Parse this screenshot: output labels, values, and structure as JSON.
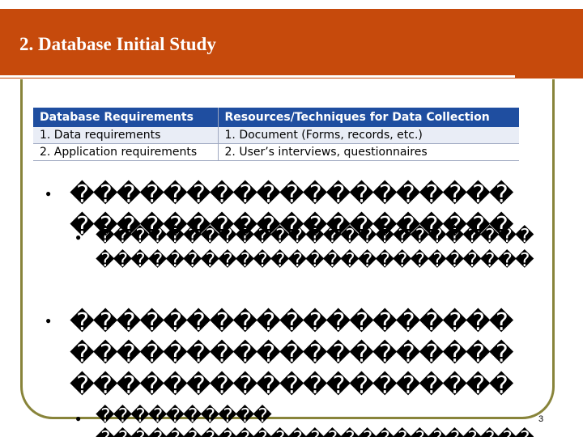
{
  "slide": {
    "title": "2. Database Initial Study",
    "page_number": "3"
  },
  "table": {
    "headers": [
      "Database Requirements",
      "Resources/Techniques for Data Collection"
    ],
    "rows": [
      [
        "1.  Data requirements",
        "1.  Document (Forms, records, etc.)"
      ],
      [
        "2.  Application requirements",
        "2.  User’s interviews, questionnaires"
      ]
    ]
  },
  "bullets": {
    "l1": "�������������������",
    "l2": "�������������������",
    "s1": "�������������������������",
    "s2": "�������������������������",
    "l3": "�������������������",
    "l4": "�������������������",
    "l5": "�������������������",
    "s3": "����������",
    "s4": "�������������������������"
  },
  "colors": {
    "header": "#c64a0c",
    "frame": "#88843a",
    "table_header": "#1f4ea0"
  }
}
